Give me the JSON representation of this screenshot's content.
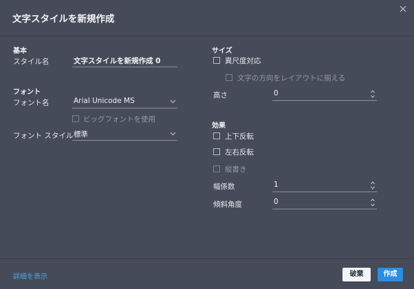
{
  "dialog": {
    "title": "文字スタイルを新規作成"
  },
  "left": {
    "basic_header": "基本",
    "style_name_label": "スタイル名",
    "style_name_value": "文字スタイルを新規作成 0",
    "font_header": "フォント",
    "font_name_label": "フォント名",
    "font_name_value": "Arial Unicode MS",
    "bigfont_label": "ビッグフォントを使用",
    "font_style_label": "フォント スタイル",
    "font_style_value": "標準"
  },
  "right": {
    "size_header": "サイズ",
    "annotative_label": "異尺度対応",
    "match_orientation_label": "文字の方向をレイアウトに揃える",
    "height_label": "高さ",
    "height_value": "0",
    "effects_header": "効果",
    "upside_down_label": "上下反転",
    "backwards_label": "左右反転",
    "vertical_label": "縦書き",
    "width_factor_label": "幅係数",
    "width_factor_value": "1",
    "oblique_angle_label": "傾斜角度",
    "oblique_angle_value": "0"
  },
  "footer": {
    "details_link": "詳細を表示",
    "cancel_label": "破棄",
    "create_label": "作成"
  },
  "colors": {
    "background": "#454b58",
    "accent": "#2d8ee0",
    "link": "#4da3e6"
  }
}
